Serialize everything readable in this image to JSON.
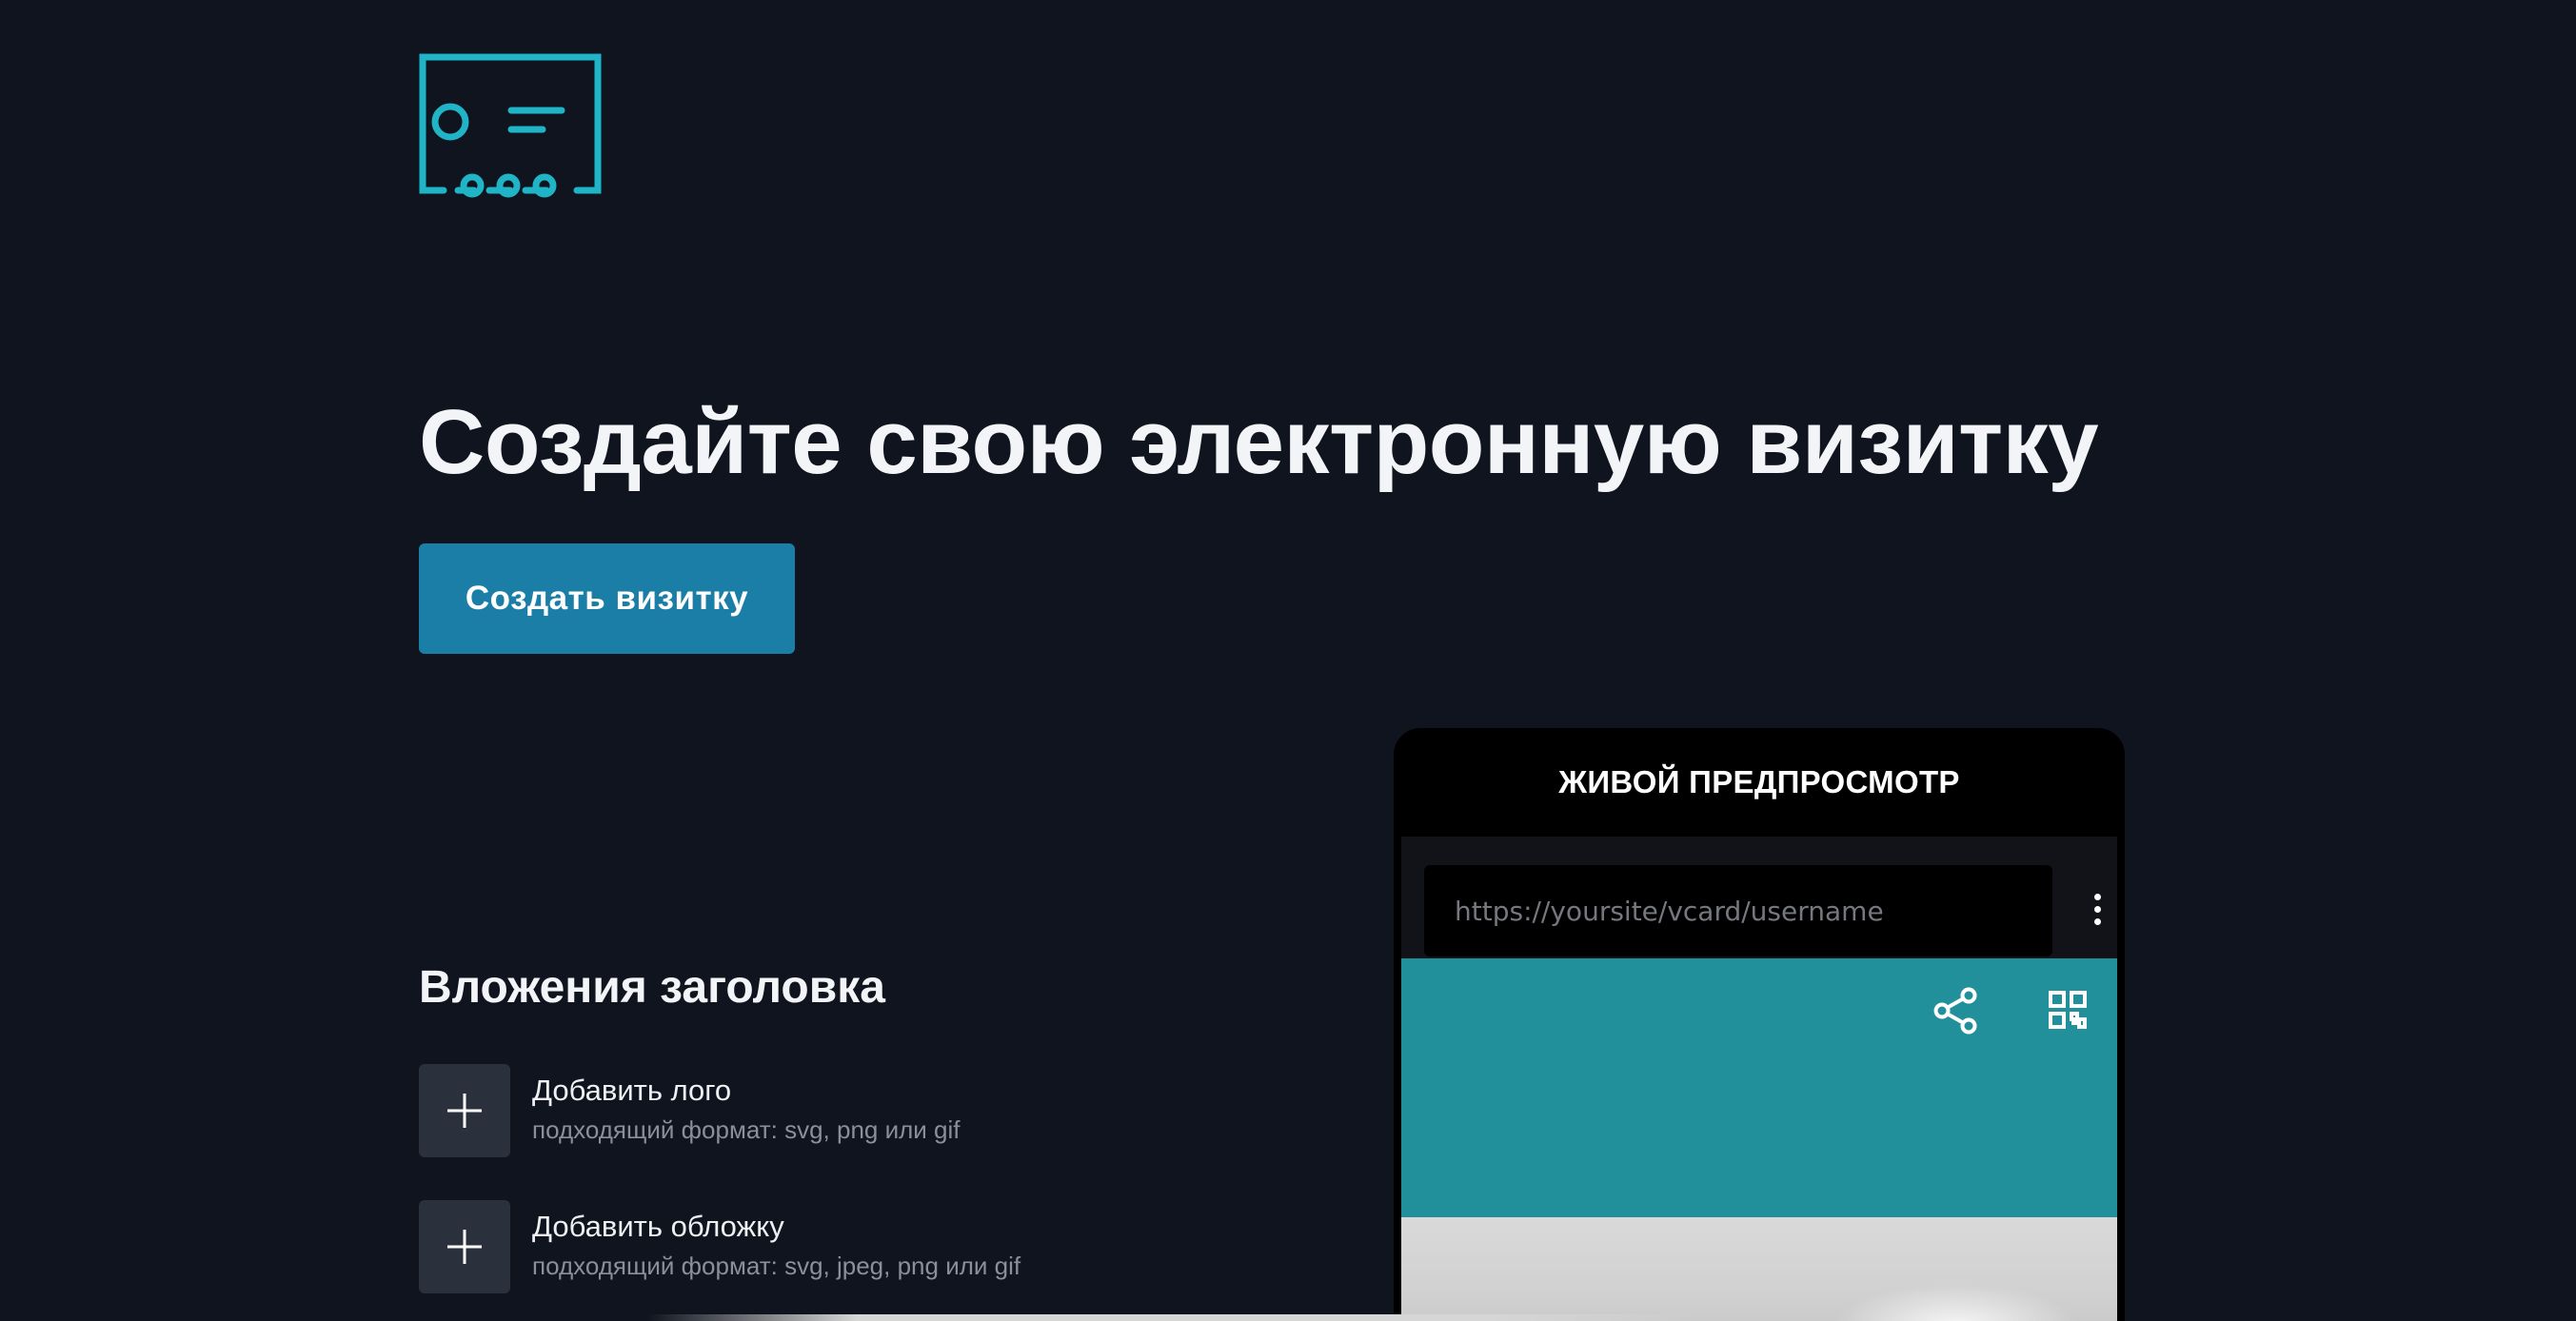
{
  "brand": {
    "logo_icon": "vcard-icon",
    "accent_color": "#1fb5c7"
  },
  "hero": {
    "title": "Создайте свою электронную визитку",
    "cta_label": "Создать визитку",
    "cta_color": "#1b7ea7"
  },
  "attachments": {
    "title": "Вложения заголовка",
    "items": [
      {
        "label": "Добавить лого",
        "hint": "подходящий формат: svg, png или gif",
        "icon": "plus-icon"
      },
      {
        "label": "Добавить обложку",
        "hint": "подходящий формат: svg, jpeg, png или gif",
        "icon": "plus-icon"
      }
    ]
  },
  "preview": {
    "title": "ЖИВОЙ ПРЕДПРОСМОТР",
    "url_placeholder": "https://yoursite/vcard/username",
    "menu_icon": "kebab-menu-icon",
    "share_icon": "share-icon",
    "qr_icon": "qr-code-icon",
    "header_color": "#21909a"
  }
}
